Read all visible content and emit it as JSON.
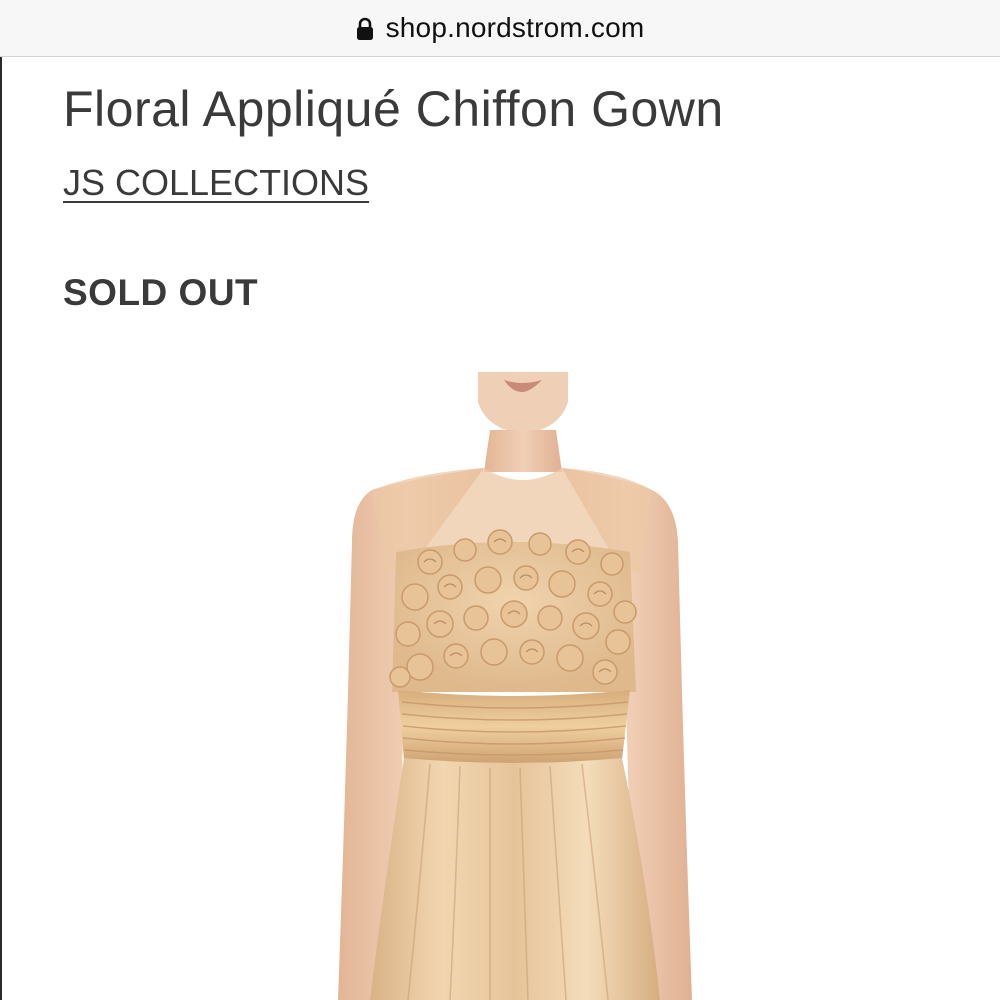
{
  "browser": {
    "url": "shop.nordstrom.com"
  },
  "product": {
    "title": "Floral Appliqué Chiffon Gown",
    "brand": "JS COLLECTIONS",
    "availability": "SOLD OUT",
    "image": {
      "subject": "model wearing a champagne floral appliqué chiffon gown",
      "dress_color": "#e8c79f"
    }
  },
  "icons": {
    "secure": "lock-icon"
  }
}
